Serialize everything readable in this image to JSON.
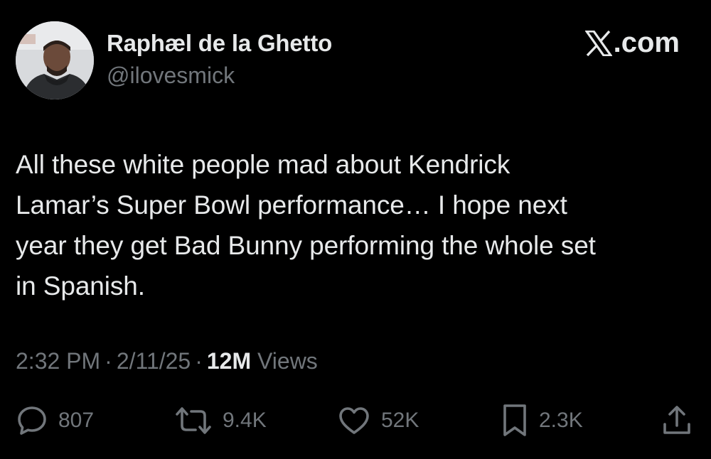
{
  "user": {
    "display_name": "Raphæl de la Ghetto",
    "handle": "@ilovesmick"
  },
  "brand": {
    "label": ".com",
    "icon": "x-logo-icon"
  },
  "tweet": {
    "text": "All these white people mad about Kendrick\nLamar’s Super Bowl performance… I hope next\nyear they get Bad Bunny performing the whole set\nin Spanish.",
    "time": "2:32 PM",
    "date": "2/11/25",
    "separator": "·",
    "views_count": "12M",
    "views_label": "Views"
  },
  "actions": {
    "reply": {
      "icon": "reply-icon",
      "count": "807"
    },
    "repost": {
      "icon": "repost-icon",
      "count": "9.4K"
    },
    "like": {
      "icon": "heart-icon",
      "count": "52K"
    },
    "bookmark": {
      "icon": "bookmark-icon",
      "count": "2.3K"
    },
    "share": {
      "icon": "share-icon"
    }
  },
  "colors": {
    "background": "#000000",
    "primary_text": "#e7e9ea",
    "secondary_text": "#71767b"
  }
}
